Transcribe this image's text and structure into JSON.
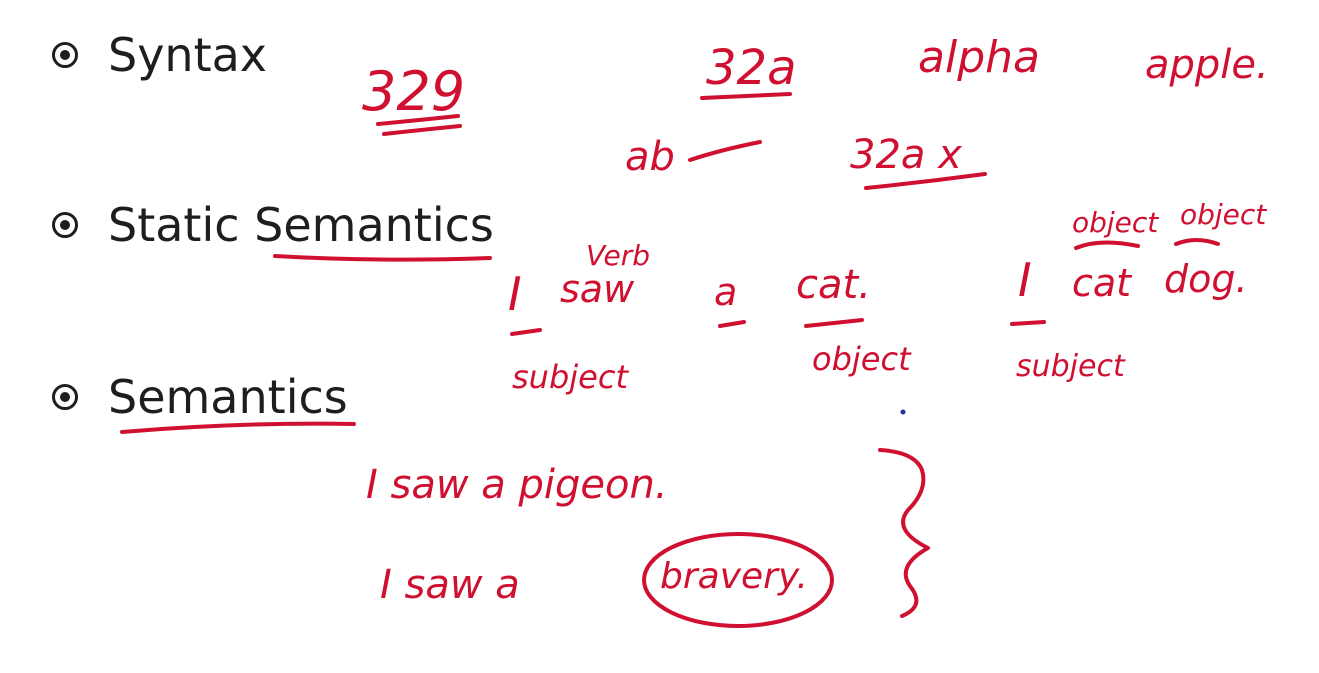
{
  "bullets": [
    {
      "label": "Syntax"
    },
    {
      "label": "Static Semantics"
    },
    {
      "label": "Semantics"
    }
  ],
  "annotations": {
    "syntax": {
      "n1": "329",
      "n2": "32a",
      "alpha": "alpha",
      "apple": "apple.",
      "ab": "ab",
      "n3": "32a x"
    },
    "static": {
      "i1": "I",
      "saw": "saw",
      "verb": "Verb",
      "a": "a",
      "cat": "cat.",
      "subject1": "subject",
      "object1": "object",
      "i2": "I",
      "cat2": "cat",
      "dog": "dog.",
      "object2": "object",
      "object3": "object",
      "subject2": "subject"
    },
    "semantics": {
      "line1": "I saw a pigeon.",
      "line2_start": "I saw  a",
      "bravery": "bravery."
    }
  },
  "colors": {
    "ink": "#d01030",
    "text": "#1e1e1e",
    "background": "#ffffff"
  }
}
